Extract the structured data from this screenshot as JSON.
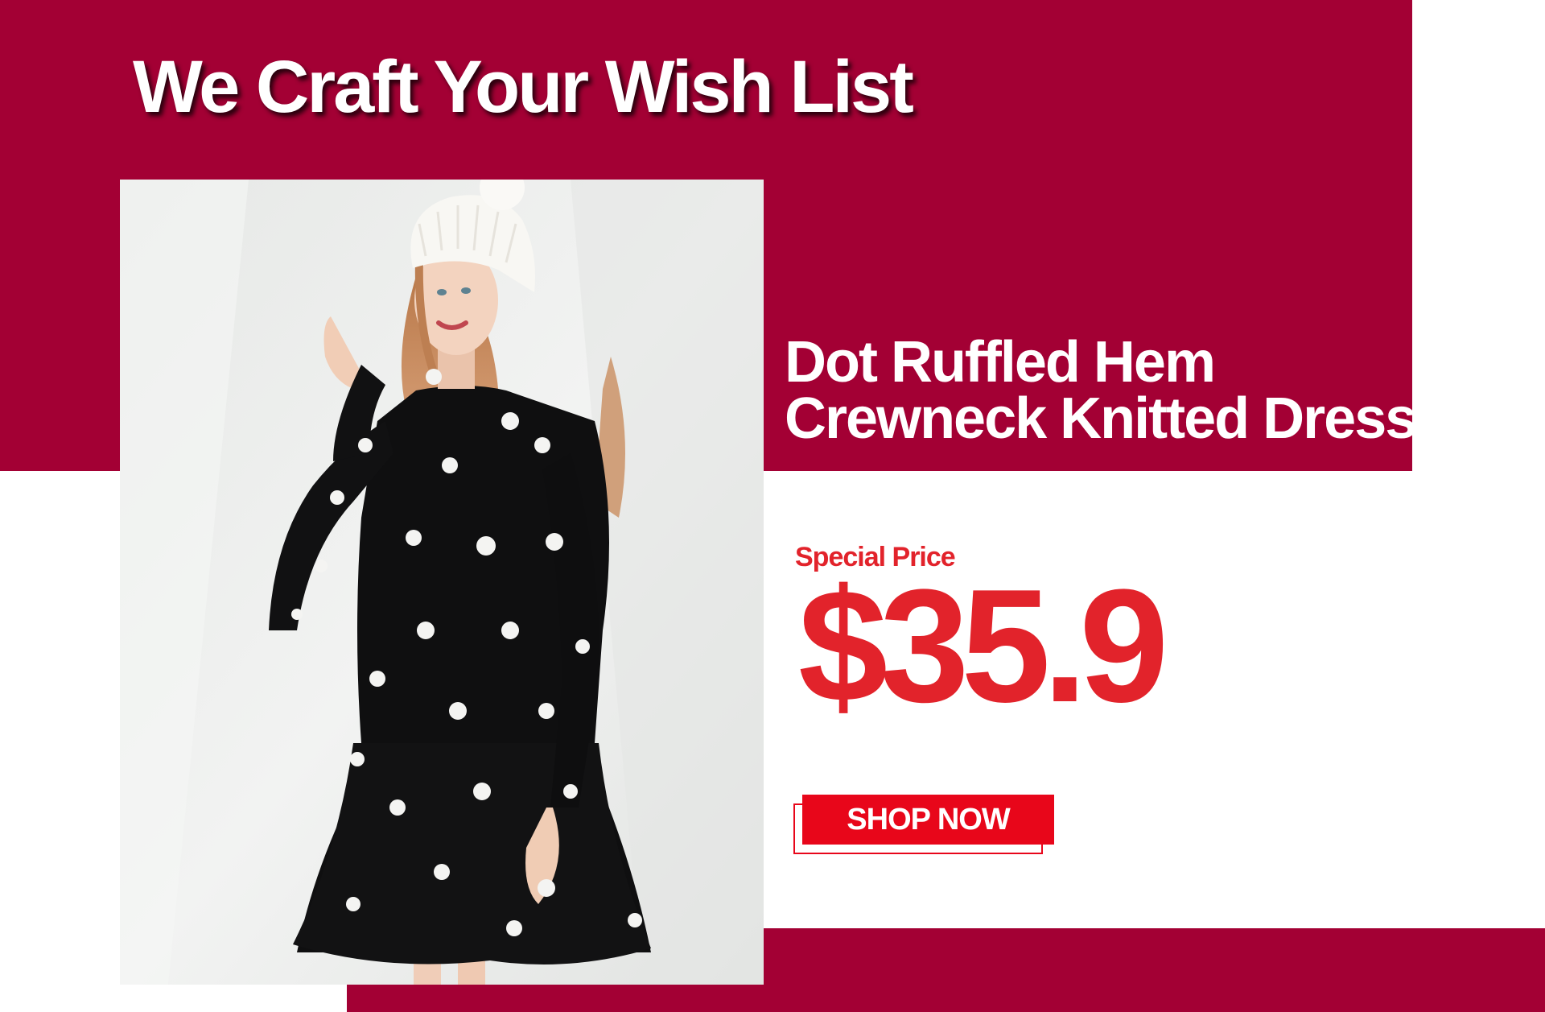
{
  "colors": {
    "crimson": "#a30034",
    "accent": "#e2232b",
    "button": "#e8061a"
  },
  "banner": {
    "headline": "We Craft Your Wish List",
    "image_alt": "model-in-polka-dot-dress",
    "product": {
      "name_line1": "Dot Ruffled Hem",
      "name_line2": "Crewneck Knitted Dress"
    },
    "price": {
      "label": "Special Price",
      "value": "$35.9"
    },
    "cta": {
      "label": "SHOP NOW"
    }
  }
}
